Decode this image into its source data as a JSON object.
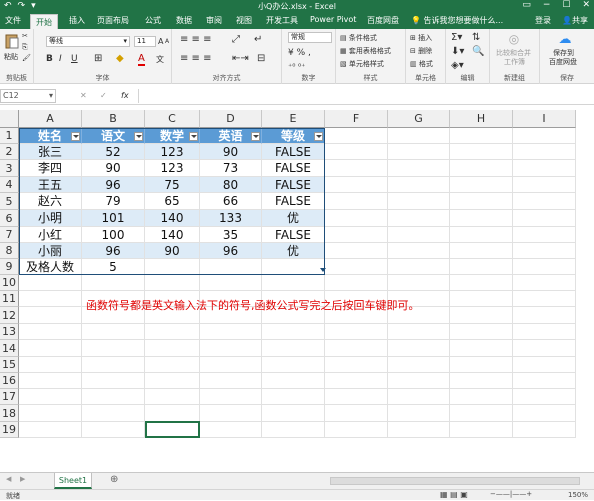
{
  "titlebar": {
    "quick_access": [
      "↶",
      "↷",
      "▾"
    ],
    "document_title": "小Q办公.xlsx - Excel",
    "window_buttons": [
      "▭",
      "−",
      "☐",
      "✕"
    ]
  },
  "tabs": [
    "文件",
    "开始",
    "插入",
    "页面布局",
    "公式",
    "数据",
    "审阅",
    "视图",
    "开发工具",
    "Power Pivot",
    "百度网盘"
  ],
  "tell_me": "告诉我您想要做什么...",
  "login": "登录",
  "share": "共享",
  "ribbon": {
    "clipboard": {
      "paste": "粘贴",
      "label": "剪贴板"
    },
    "font": {
      "name": "等线",
      "size": "11",
      "grow": "A",
      "shrink": "A",
      "bold": "B",
      "italic": "I",
      "underline": "U",
      "label": "字体",
      "wen": "文"
    },
    "align": {
      "label": "对齐方式"
    },
    "number": {
      "format": "常规",
      "label": "数字"
    },
    "styles": {
      "cond": "条件格式",
      "table": "套用表格格式",
      "cell": "单元格样式",
      "label": "样式"
    },
    "cells": {
      "insert": "插入",
      "delete": "删除",
      "format": "格式",
      "label": "单元格"
    },
    "editing": {
      "label": "编辑"
    },
    "newgroup": {
      "merge1": "比较和合并",
      "merge2": "工作簿",
      "label": "新建组"
    },
    "save": {
      "save1": "保存到",
      "save2": "百度网盘",
      "label": "保存"
    }
  },
  "formula_bar": {
    "name_box": "C12",
    "fx": "fx"
  },
  "columns": [
    "A",
    "B",
    "C",
    "D",
    "E",
    "F",
    "G",
    "H",
    "I"
  ],
  "rows": [
    "1",
    "2",
    "3",
    "4",
    "5",
    "6",
    "7",
    "8",
    "9",
    "10",
    "11",
    "12",
    "13",
    "14",
    "15",
    "16",
    "17",
    "18",
    "19"
  ],
  "table": {
    "header": [
      "姓名",
      "语文",
      "数学",
      "英语",
      "等级"
    ],
    "data": [
      [
        "张三",
        "52",
        "123",
        "90",
        "FALSE"
      ],
      [
        "李四",
        "90",
        "123",
        "73",
        "FALSE"
      ],
      [
        "王五",
        "96",
        "75",
        "80",
        "FALSE"
      ],
      [
        "赵六",
        "79",
        "65",
        "66",
        "FALSE"
      ],
      [
        "小明",
        "101",
        "140",
        "133",
        "优"
      ],
      [
        "小红",
        "100",
        "140",
        "35",
        "FALSE"
      ],
      [
        "小丽",
        "96",
        "90",
        "96",
        "优"
      ]
    ],
    "pass_label": "及格人数",
    "pass_value": "5"
  },
  "note": "函数符号都是英文输入法下的符号,函数公式写完之后按回车键即可。",
  "sheet": {
    "name": "Sheet1",
    "add": "⊕"
  },
  "status": {
    "left": "就绪",
    "zoom": "150%"
  },
  "colors": {
    "excel_green": "#217346",
    "table_header": "#5b9bd5",
    "table_band": "#ddebf7",
    "note": "#e00000"
  }
}
